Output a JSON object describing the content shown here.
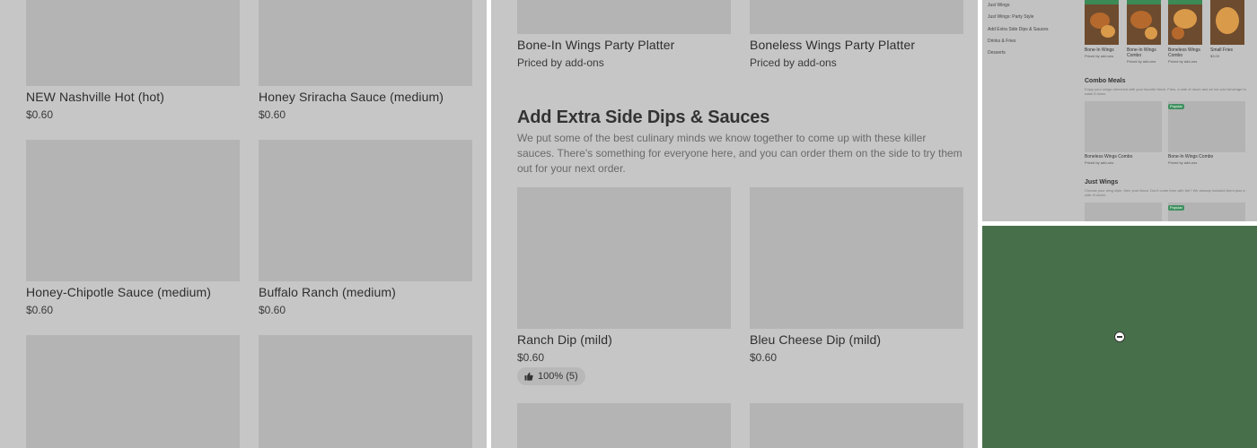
{
  "left_panel": {
    "items": [
      {
        "name": "NEW Nashville Hot (hot)",
        "price": "$0.60"
      },
      {
        "name": "Honey Sriracha Sauce (medium)",
        "price": "$0.60"
      },
      {
        "name": "Honey-Chipotle Sauce (medium)",
        "price": "$0.60"
      },
      {
        "name": "Buffalo Ranch (medium)",
        "price": "$0.60"
      }
    ]
  },
  "middle_panel": {
    "top_items": [
      {
        "name": "Bone-In Wings Party Platter",
        "price": "Priced by add-ons"
      },
      {
        "name": "Boneless Wings Party Platter",
        "price": "Priced by add-ons"
      }
    ],
    "section_title": "Add Extra Side Dips & Sauces",
    "section_description": "We put some of the best culinary minds we know together to come up with these killer sauces. There's something for everyone here, and you can order them on the side to try them out for your next order.",
    "items": [
      {
        "name": "Ranch Dip (mild)",
        "price": "$0.60",
        "rating": "100% (5)"
      },
      {
        "name": "Bleu Cheese Dip (mild)",
        "price": "$0.60"
      }
    ]
  },
  "thumbnail": {
    "nav": [
      "Just Wings",
      "Just Wings: Party Style",
      "Add Extra Side Dips & Sauces",
      "Drinks & Fries",
      "Desserts"
    ],
    "top_items": [
      {
        "name": "Bone-In Wings",
        "price": "Priced by add-ons"
      },
      {
        "name": "Bone-In Wings Combo",
        "price": "Priced by add-ons"
      },
      {
        "name": "Boneless Wings Combo",
        "price": "Priced by add-ons"
      },
      {
        "name": "Small Fries",
        "price": "$3.00"
      }
    ],
    "combo_title": "Combo Meals",
    "combo_desc": "Enjoy your wings drenched with your favorite flavor. Fries, a side of ranch and an ice cold beverage to wash it down.",
    "combo_items": [
      {
        "name": "Boneless Wings Combo",
        "price": "Priced by add-ons"
      },
      {
        "name": "Bone-In Wings Combo",
        "price": "Priced by add-ons"
      }
    ],
    "popular_label": "Popular",
    "just_wings_title": "Just Wings",
    "just_wings_desc": "Choose your wing style, then your flavor. Don't come from with the? We already included them plus a side of ranch."
  },
  "colors": {
    "overlay_gray": "#c6c6c6",
    "image_placeholder": "#b4b4b4",
    "green_panel": "#47704a",
    "popular_green": "#3f9160"
  }
}
